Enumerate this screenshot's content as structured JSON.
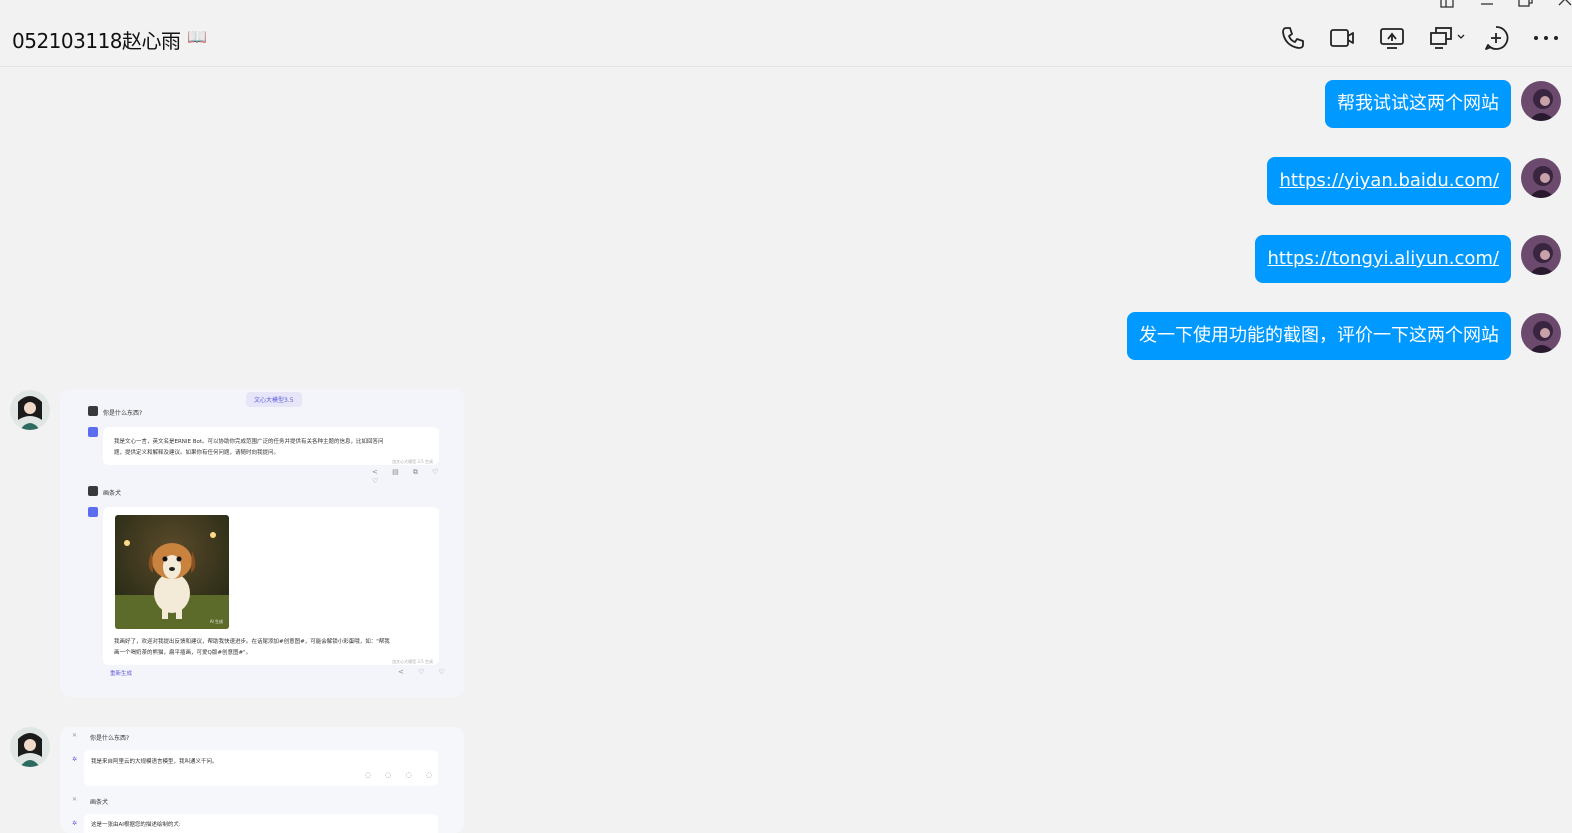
{
  "header": {
    "title": "052103118赵心雨",
    "book_glyph": "📖"
  },
  "messages": [
    {
      "text": "帮我试试这两个网站",
      "link": false
    },
    {
      "text": "https://yiyan.baidu.com/",
      "link": true
    },
    {
      "text": "https://tongyi.aliyun.com/",
      "link": true
    },
    {
      "text": "发一下使用功能的截图，评价一下这两个网站",
      "link": false
    }
  ],
  "shot1": {
    "model_pill": "文心大模型3.5",
    "q1": "你是什么东西?",
    "a1_line1": "我是文心一言，英文名是ERNIE Bot。可以协助你完成范围广泛的任务并提供有关各种主题的信息，比如回答问",
    "a1_line2": "题，提供定义和解释及建议。如果你有任何问题，请随时向我提问。",
    "a1_footer": "由文心大模型 3.5 生成",
    "q2": "画条犬",
    "img_tag": "AI 生成",
    "a2_line1": "我画好了，欢迎对我提出反馈和建议，帮助我快速进步。在话尾添加#创意图#，可能会解锁小彩蛋哦，如：\"帮我",
    "a2_line2": "画一个喝奶茶的熊猫，扁平插画，可爱Q版#创意图#\"。",
    "a2_footer": "由文心大模型 3.5 生成",
    "regen": "重新生成"
  },
  "shot2": {
    "q1": "你是什么东西?",
    "a1": "我是来自阿里云的大规模语言模型，我叫通义千问。",
    "q2": "画条犬",
    "a2": "这是一张由AI根据您的描述绘制的犬:"
  },
  "colors": {
    "bubble": "#0099ff",
    "background": "#f2f2f2",
    "accent": "#5a5adb"
  }
}
